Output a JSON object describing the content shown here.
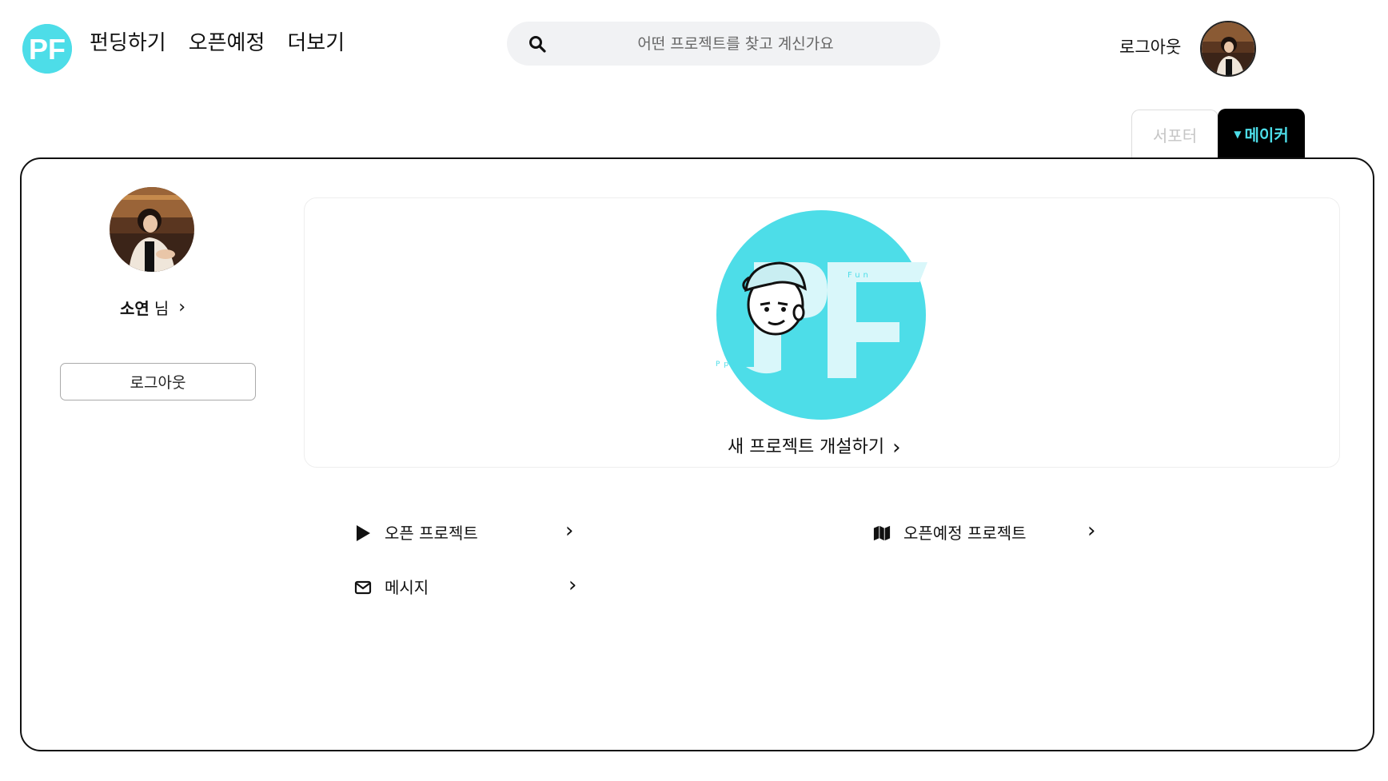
{
  "header": {
    "logo_text": "PF",
    "nav": [
      "펀딩하기",
      "오픈예정",
      "더보기"
    ],
    "search_placeholder": "어떤 프로젝트를 찾고 계신가요",
    "logout_label": "로그아웃"
  },
  "role_tabs": {
    "supporter_label": "서포터",
    "maker_label": "메이커",
    "active": "maker"
  },
  "sidebar": {
    "user_name": "소연",
    "user_suffix": "님",
    "logout_label": "로그아웃"
  },
  "new_project": {
    "logo_fun_text": "Fun",
    "logo_ppeon_text": "Ppeon",
    "cta_label": "새 프로젝트 개설하기"
  },
  "menu": {
    "open_projects": "오픈 프로젝트",
    "upcoming_projects": "오픈예정 프로젝트",
    "messages": "메시지"
  },
  "colors": {
    "brand": "#4ddde8",
    "active_tab_bg": "#000000"
  }
}
